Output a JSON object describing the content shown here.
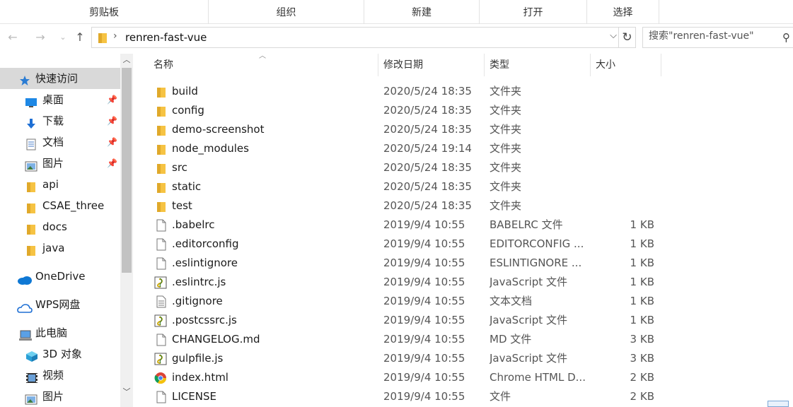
{
  "ribbon": {
    "groups": [
      "剪贴板",
      "组织",
      "新建",
      "打开",
      "选择"
    ]
  },
  "addressbar": {
    "path": "renren-fast-vue",
    "search_placeholder": "搜索\"renren-fast-vue\""
  },
  "sidebar": {
    "items": [
      {
        "label": "快速访问",
        "icon": "star-icon"
      },
      {
        "label": "桌面",
        "icon": "desktop-icon",
        "pinned": true
      },
      {
        "label": "下载",
        "icon": "download-icon",
        "pinned": true
      },
      {
        "label": "文档",
        "icon": "document-icon",
        "pinned": true
      },
      {
        "label": "图片",
        "icon": "pictures-icon",
        "pinned": true
      },
      {
        "label": "api",
        "icon": "folder-icon"
      },
      {
        "label": "CSAE_three",
        "icon": "folder-icon"
      },
      {
        "label": "docs",
        "icon": "folder-icon"
      },
      {
        "label": "java",
        "icon": "folder-icon"
      },
      {
        "label": "OneDrive",
        "icon": "cloud-icon"
      },
      {
        "label": "WPS网盘",
        "icon": "wps-cloud-icon"
      },
      {
        "label": "此电脑",
        "icon": "computer-icon"
      },
      {
        "label": "3D 对象",
        "icon": "3d-objects-icon"
      },
      {
        "label": "视频",
        "icon": "video-icon"
      },
      {
        "label": "图片",
        "icon": "pictures-icon"
      }
    ]
  },
  "columns": {
    "name": "名称",
    "modified": "修改日期",
    "type": "类型",
    "size": "大小"
  },
  "files": [
    {
      "name": "build",
      "modified": "2020/5/24 18:35",
      "type": "文件夹",
      "size": "",
      "icon": "folder-icon"
    },
    {
      "name": "config",
      "modified": "2020/5/24 18:35",
      "type": "文件夹",
      "size": "",
      "icon": "folder-icon"
    },
    {
      "name": "demo-screenshot",
      "modified": "2020/5/24 18:35",
      "type": "文件夹",
      "size": "",
      "icon": "folder-icon"
    },
    {
      "name": "node_modules",
      "modified": "2020/5/24 19:14",
      "type": "文件夹",
      "size": "",
      "icon": "folder-icon"
    },
    {
      "name": "src",
      "modified": "2020/5/24 18:35",
      "type": "文件夹",
      "size": "",
      "icon": "folder-icon"
    },
    {
      "name": "static",
      "modified": "2020/5/24 18:35",
      "type": "文件夹",
      "size": "",
      "icon": "folder-icon"
    },
    {
      "name": "test",
      "modified": "2020/5/24 18:35",
      "type": "文件夹",
      "size": "",
      "icon": "folder-icon"
    },
    {
      "name": ".babelrc",
      "modified": "2019/9/4 10:55",
      "type": "BABELRC 文件",
      "size": "1 KB",
      "icon": "file-icon"
    },
    {
      "name": ".editorconfig",
      "modified": "2019/9/4 10:55",
      "type": "EDITORCONFIG ...",
      "size": "1 KB",
      "icon": "file-icon"
    },
    {
      "name": ".eslintignore",
      "modified": "2019/9/4 10:55",
      "type": "ESLINTIGNORE ...",
      "size": "1 KB",
      "icon": "file-icon"
    },
    {
      "name": ".eslintrc.js",
      "modified": "2019/9/4 10:55",
      "type": "JavaScript 文件",
      "size": "1 KB",
      "icon": "js-file-icon"
    },
    {
      "name": ".gitignore",
      "modified": "2019/9/4 10:55",
      "type": "文本文档",
      "size": "1 KB",
      "icon": "text-file-icon"
    },
    {
      "name": ".postcssrc.js",
      "modified": "2019/9/4 10:55",
      "type": "JavaScript 文件",
      "size": "1 KB",
      "icon": "js-file-icon"
    },
    {
      "name": "CHANGELOG.md",
      "modified": "2019/9/4 10:55",
      "type": "MD 文件",
      "size": "3 KB",
      "icon": "file-icon"
    },
    {
      "name": "gulpfile.js",
      "modified": "2019/9/4 10:55",
      "type": "JavaScript 文件",
      "size": "3 KB",
      "icon": "js-file-icon"
    },
    {
      "name": "index.html",
      "modified": "2019/9/4 10:55",
      "type": "Chrome HTML D...",
      "size": "2 KB",
      "icon": "chrome-icon"
    },
    {
      "name": "LICENSE",
      "modified": "2019/9/4 10:55",
      "type": "文件",
      "size": "2 KB",
      "icon": "file-icon"
    }
  ],
  "colors": {
    "folder": "#f6c343",
    "selection": "#d9d9d9",
    "onedrive": "#0f78d4",
    "star": "#2b7cd3"
  }
}
